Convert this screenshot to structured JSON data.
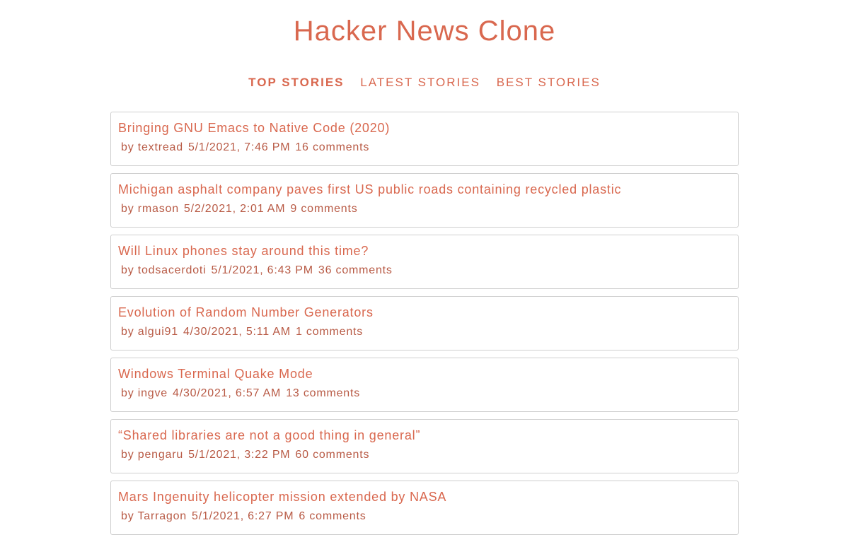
{
  "app": {
    "title": "Hacker News Clone"
  },
  "nav": {
    "tabs": [
      {
        "label": "TOP STORIES",
        "active": true
      },
      {
        "label": "LATEST STORIES",
        "active": false
      },
      {
        "label": "BEST STORIES",
        "active": false
      }
    ]
  },
  "stories": [
    {
      "title": "Bringing GNU Emacs to Native Code (2020)",
      "author": "by textread",
      "time": "5/1/2021, 7:46 PM",
      "comments": "16 comments"
    },
    {
      "title": "Michigan asphalt company paves first US public roads containing recycled plastic",
      "author": "by rmason",
      "time": "5/2/2021, 2:01 AM",
      "comments": "9 comments"
    },
    {
      "title": "Will Linux phones stay around this time?",
      "author": "by todsacerdoti",
      "time": "5/1/2021, 6:43 PM",
      "comments": "36 comments"
    },
    {
      "title": "Evolution of Random Number Generators",
      "author": "by algui91",
      "time": "4/30/2021, 5:11 AM",
      "comments": "1 comments"
    },
    {
      "title": "Windows Terminal Quake Mode",
      "author": "by ingve",
      "time": "4/30/2021, 6:57 AM",
      "comments": "13 comments"
    },
    {
      "title": "“Shared libraries are not a good thing in general”",
      "author": "by pengaru",
      "time": "5/1/2021, 3:22 PM",
      "comments": "60 comments"
    },
    {
      "title": "Mars Ingenuity helicopter mission extended by NASA",
      "author": "by Tarragon",
      "time": "5/1/2021, 6:27 PM",
      "comments": "6 comments"
    }
  ],
  "colors": {
    "accent": "#d9684f",
    "meta_text": "#b85a45",
    "card_border": "#cfcfcf"
  }
}
